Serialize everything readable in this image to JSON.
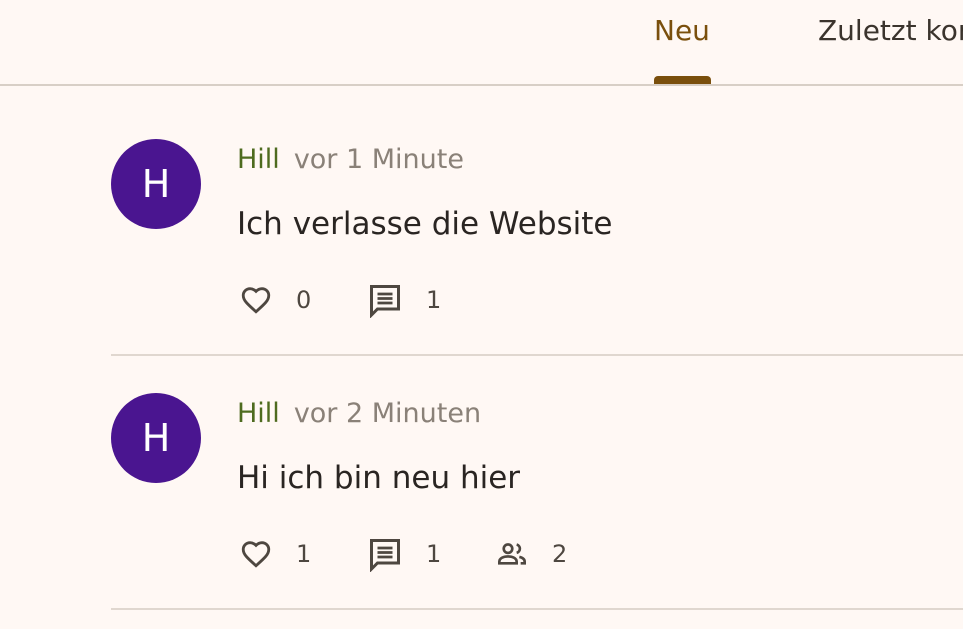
{
  "tabs": {
    "new_label": "Neu",
    "recent_label": "Zuletzt kommentiert"
  },
  "posts": [
    {
      "avatar_letter": "H",
      "author": "Hill",
      "time": "vor 1 Minute",
      "text": "Ich verlasse die Website",
      "likes": "0",
      "comments": "1"
    },
    {
      "avatar_letter": "H",
      "author": "Hill",
      "time": "vor 2 Minuten",
      "text": "Hi ich bin neu hier",
      "likes": "1",
      "comments": "1",
      "participants": "2"
    }
  ],
  "colors": {
    "background": "#fff8f4",
    "accent": "#7a4f0c",
    "author": "#4e6b1f",
    "avatar": "#4a1590"
  },
  "icons": [
    "heart-outline-icon",
    "comment-icon",
    "people-icon"
  ]
}
